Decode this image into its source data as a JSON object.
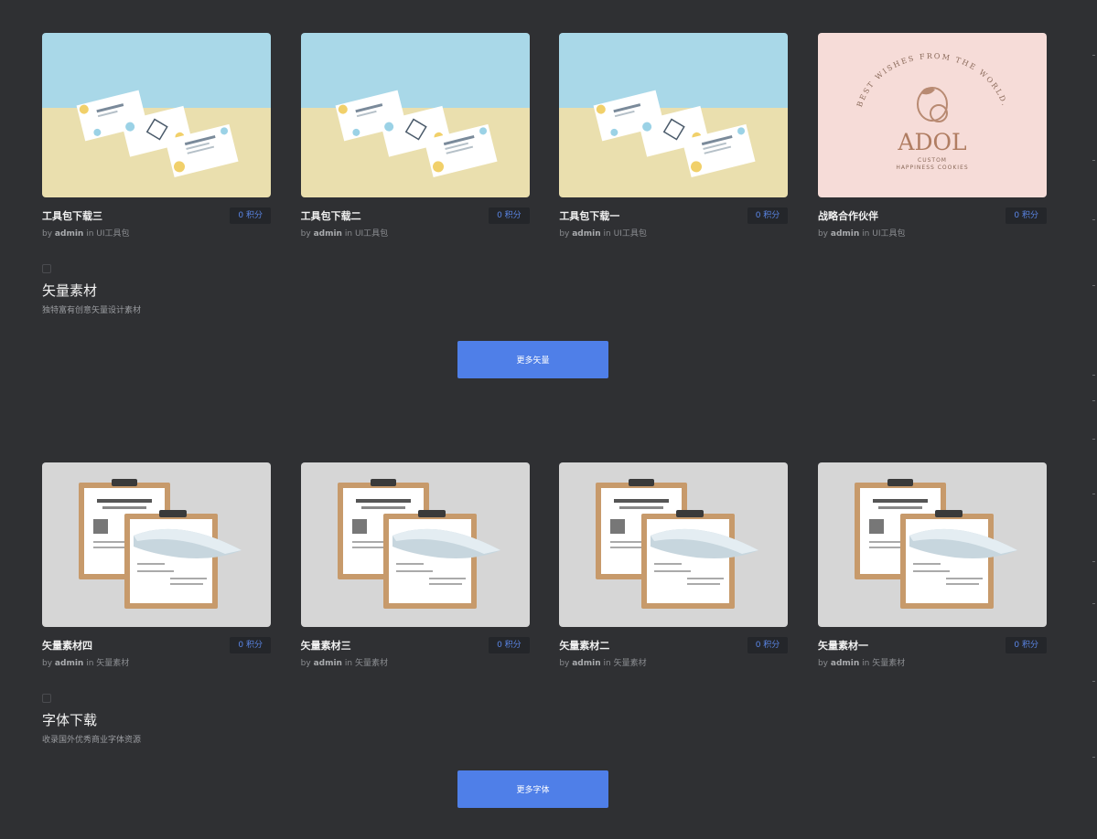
{
  "colors": {
    "background": "#2f3033",
    "accent": "#4f7fe8",
    "badge_bg": "#24262a",
    "badge_text": "#5a86e6"
  },
  "byline": {
    "by": "by",
    "in": "in"
  },
  "row1": [
    {
      "title": "工具包下载三",
      "points": "0 积分",
      "author": "admin",
      "category": "UI工具包",
      "image": "business-cards-mockup"
    },
    {
      "title": "工具包下载二",
      "points": "0 积分",
      "author": "admin",
      "category": "UI工具包",
      "image": "business-cards-mockup"
    },
    {
      "title": "工具包下载一",
      "points": "0 积分",
      "author": "admin",
      "category": "UI工具包",
      "image": "business-cards-mockup"
    },
    {
      "title": "战略合作伙伴",
      "points": "0 积分",
      "author": "admin",
      "category": "UI工具包",
      "image": "adol-logo-card",
      "logo": {
        "arc": "BEST WISHES FROM THE WORLD.",
        "brand": "ADOL",
        "line1": "CUSTOM",
        "line2": "HAPPINESS COOKIES"
      }
    }
  ],
  "vector_section": {
    "title": "矢量素材",
    "subtitle": "独特富有创意矢量设计素材",
    "button": "更多矢量"
  },
  "row2": [
    {
      "title": "矢量素材四",
      "points": "0 积分",
      "author": "admin",
      "category": "矢量素材",
      "image": "clipboard-mockup"
    },
    {
      "title": "矢量素材三",
      "points": "0 积分",
      "author": "admin",
      "category": "矢量素材",
      "image": "clipboard-mockup"
    },
    {
      "title": "矢量素材二",
      "points": "0 积分",
      "author": "admin",
      "category": "矢量素材",
      "image": "clipboard-mockup"
    },
    {
      "title": "矢量素材一",
      "points": "0 积分",
      "author": "admin",
      "category": "矢量素材",
      "image": "clipboard-mockup"
    }
  ],
  "font_section": {
    "title": "字体下载",
    "subtitle": "收录国外优秀商业字体资源",
    "button": "更多字体"
  }
}
